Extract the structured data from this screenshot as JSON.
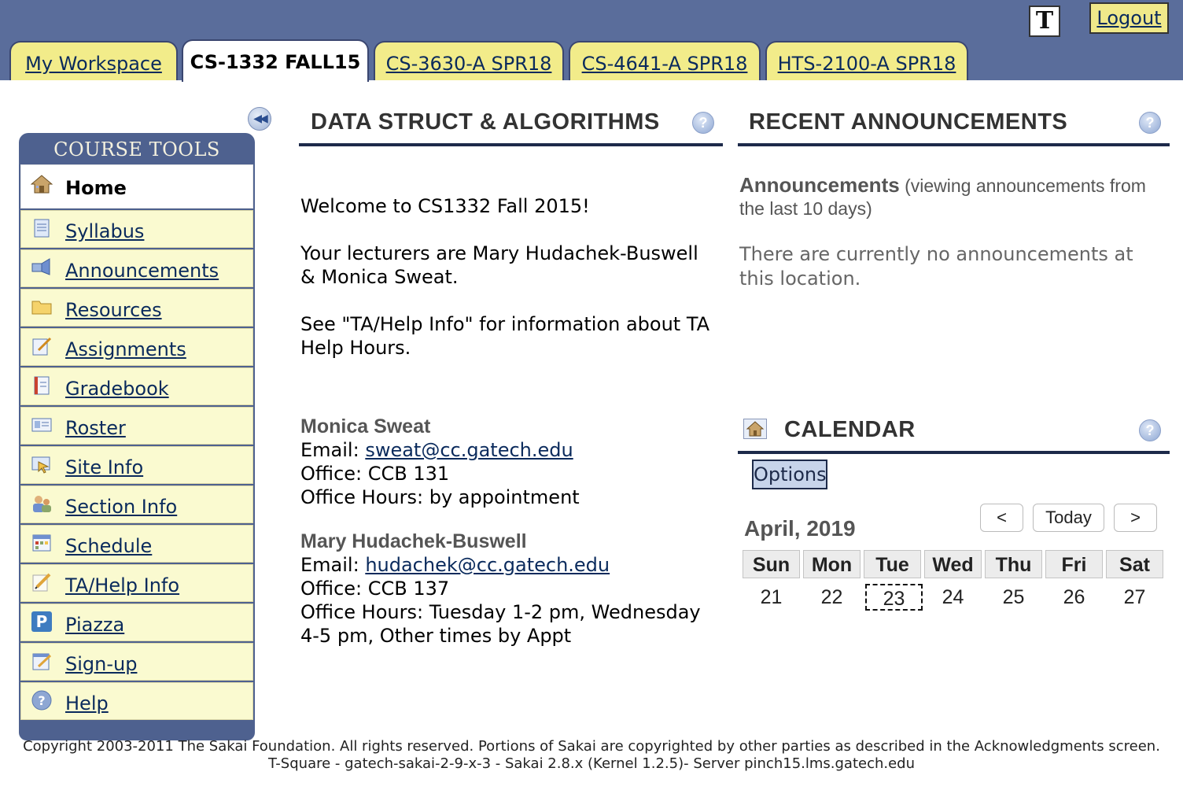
{
  "header": {
    "text_toggle_label": "T",
    "logout_label": "Logout",
    "tabs": [
      {
        "label": "My Workspace",
        "active": false
      },
      {
        "label": "CS-1332 FALL15",
        "active": true
      },
      {
        "label": "CS-3630-A SPR18",
        "active": false
      },
      {
        "label": "CS-4641-A SPR18",
        "active": false
      },
      {
        "label": "HTS-2100-A SPR18",
        "active": false
      }
    ]
  },
  "sidebar": {
    "title": "COURSE TOOLS",
    "items": [
      {
        "label": "Home",
        "icon": "home-icon",
        "current": true
      },
      {
        "label": "Syllabus",
        "icon": "syllabus-icon"
      },
      {
        "label": "Announcements",
        "icon": "announcements-icon"
      },
      {
        "label": "Resources",
        "icon": "folder-icon"
      },
      {
        "label": "Assignments",
        "icon": "assignments-icon"
      },
      {
        "label": "Gradebook",
        "icon": "gradebook-icon"
      },
      {
        "label": "Roster",
        "icon": "roster-icon"
      },
      {
        "label": "Site Info",
        "icon": "site-info-icon"
      },
      {
        "label": "Section Info",
        "icon": "section-info-icon"
      },
      {
        "label": "Schedule",
        "icon": "schedule-icon"
      },
      {
        "label": "TA/Help Info",
        "icon": "pencil-icon"
      },
      {
        "label": "Piazza",
        "icon": "piazza-icon"
      },
      {
        "label": "Sign-up",
        "icon": "signup-icon"
      },
      {
        "label": "Help",
        "icon": "help-icon"
      }
    ]
  },
  "overview": {
    "title": "DATA STRUCT & ALGORITHMS",
    "welcome": "Welcome to CS1332 Fall 2015!",
    "lecturers": "Your lecturers are Mary Hudachek-Buswell & Monica Sweat.",
    "ta_info": "See \"TA/Help Info\" for information about TA Help Hours.",
    "people": [
      {
        "name": "Monica Sweat",
        "email_prefix": "Email: ",
        "email": "sweat@cc.gatech.edu",
        "office": "Office: CCB 131",
        "hours": "Office Hours: by appointment"
      },
      {
        "name": "Mary Hudachek-Buswell",
        "email_prefix": "Email: ",
        "email": "hudachek@cc.gatech.edu",
        "office": "Office: CCB 137",
        "hours": "Office Hours: Tuesday 1-2 pm, Wednesday 4-5 pm, Other times by Appt"
      }
    ]
  },
  "announcements": {
    "title": "RECENT ANNOUNCEMENTS",
    "heading": "Announcements",
    "subheading": "(viewing announcements from the last 10 days)",
    "empty_text": "There are currently no announcements at this location."
  },
  "calendar": {
    "title": "CALENDAR",
    "options_label": "Options",
    "prev_label": "<",
    "today_label": "Today",
    "next_label": ">",
    "month": "April, 2019",
    "weekdays": [
      "Sun",
      "Mon",
      "Tue",
      "Wed",
      "Thu",
      "Fri",
      "Sat"
    ],
    "days": [
      "21",
      "22",
      "23",
      "24",
      "25",
      "26",
      "27"
    ],
    "today_day": "23"
  },
  "footer": {
    "copyright": "Copyright 2003-2011 The Sakai Foundation. All rights reserved. Portions of Sakai are copyrighted by other parties as described in the Acknowledgments screen.",
    "server": "T-Square - gatech-sakai-2-9-x-3 - Sakai 2.8.x (Kernel 1.2.5)- Server pinch15.lms.gatech.edu"
  },
  "help_icon_label": "?"
}
